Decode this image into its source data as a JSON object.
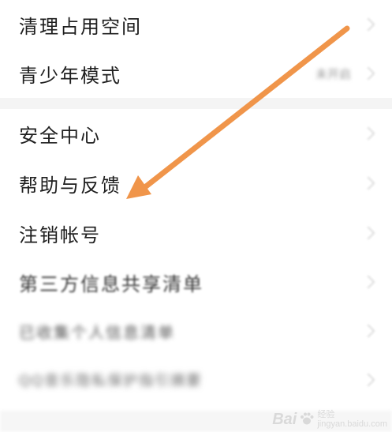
{
  "menu_items": [
    {
      "label": "清理占用空间",
      "value": ""
    },
    {
      "label": "青少年模式",
      "value": "未开启"
    },
    {
      "label": "安全中心",
      "value": ""
    },
    {
      "label": "帮助与反馈",
      "value": ""
    },
    {
      "label": "注销帐号",
      "value": ""
    },
    {
      "label": "第三方信息共享清单",
      "value": ""
    },
    {
      "label": "已收集个人信息清单",
      "value": ""
    },
    {
      "label": "QQ音乐隐私保护指引摘要",
      "value": ""
    }
  ],
  "annotation": {
    "arrow_color": "#f0954a"
  },
  "watermark": {
    "brand": "Bai",
    "brand_suffix": "经验",
    "site": "jingyan.baidu.com"
  }
}
